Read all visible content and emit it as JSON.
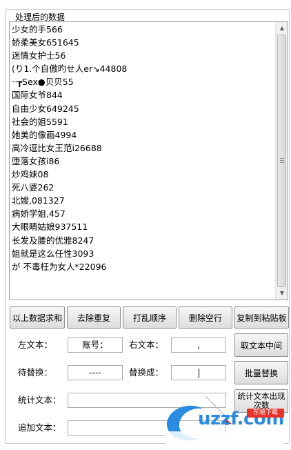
{
  "group": {
    "title": "处理后的数据"
  },
  "list": {
    "items": [
      "少女的手566",
      "娇柔美女651645",
      "迷情女护士56",
      "(り1.个自傲旳せ人er↘44808",
      "┈┲Sex●贝贝55",
      "国际女爷844",
      "自由少女649245",
      "社会的姐5591",
      "她美的像画4994",
      "高冷逗比女王范i26688",
      "堕落女孩i86",
      "炒鸡妹08",
      "死八婆262",
      "北嫂,081327",
      "病娇学姐,457",
      "大眼睛姑娘937511",
      "长发及腰的优雅8247",
      "姐就是这么任性3093",
      "が 不毒枉为女人*22096"
    ]
  },
  "scrollbar": {
    "up_icon": "arrow-up-icon",
    "down_icon": "arrow-down-icon"
  },
  "buttons": {
    "sum": "以上数据求和",
    "dedupe": "去除重复",
    "shuffle": "打乱顺序",
    "delete_blank": "删除空行",
    "copy": "复制到粘贴板",
    "extract_middle": "取文本中间",
    "batch_replace": "批量替换",
    "count_line1": "统计文本出现",
    "count_line2": "次数"
  },
  "form": {
    "left_label": "左文本：",
    "left_value": "账号：",
    "right_label": "右文本：",
    "right_value": ",",
    "find_label": "待替换：",
    "find_value": "----",
    "replace_label": "替换成：",
    "replace_value": "",
    "count_label": "统计文本：",
    "count_value": "",
    "append_label": "追加文本：",
    "append_value": ""
  },
  "watermark": {
    "text": "uzzf.com",
    "tag": "东坡下载",
    "colors": {
      "blue": "#2a8be0",
      "red": "#e8322a"
    }
  }
}
